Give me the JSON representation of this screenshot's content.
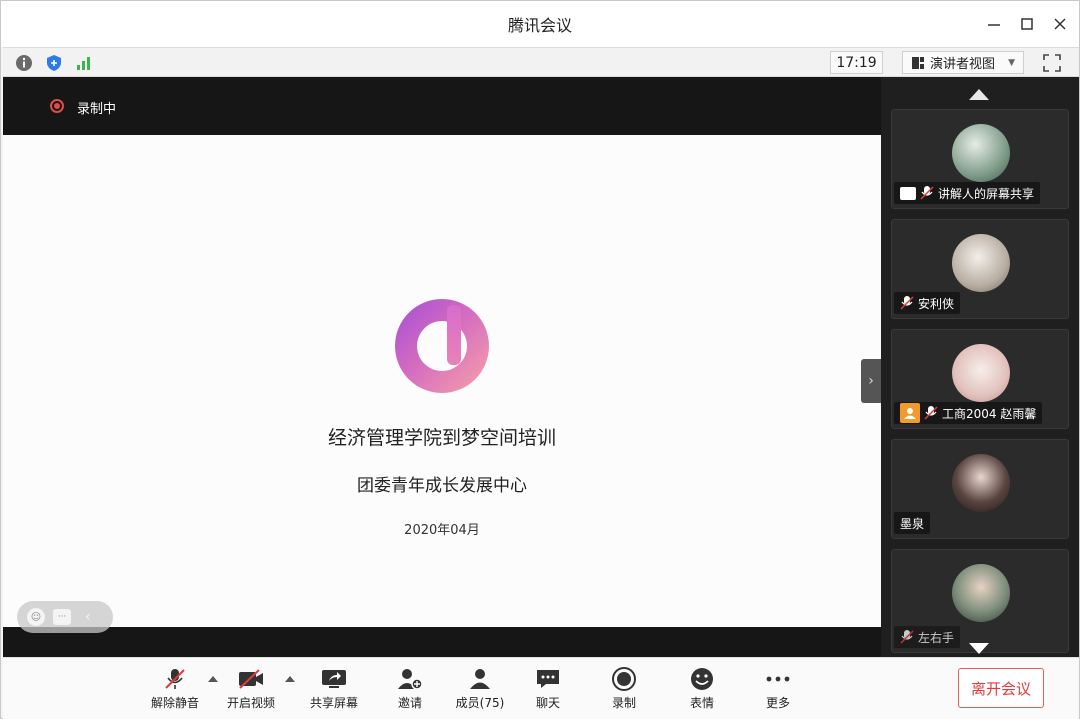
{
  "window": {
    "title": "腾讯会议"
  },
  "topbar": {
    "clock": "17:19",
    "view_label": "演讲者视图"
  },
  "recording": {
    "label": "录制中"
  },
  "slide": {
    "title": "经济管理学院到梦空间培训",
    "subtitle": "团委青年成长发展中心",
    "date": "2020年04月"
  },
  "participants": [
    {
      "name": "讲解人的屏幕共享",
      "sharing": true,
      "muted": true,
      "host": false,
      "avatar_color": "#9db3a4"
    },
    {
      "name": "安利侠",
      "sharing": false,
      "muted": true,
      "host": false,
      "avatar_color": "#c9c2b8"
    },
    {
      "name": "工商2004 赵雨馨",
      "sharing": false,
      "muted": true,
      "host": true,
      "avatar_color": "#e6c9c4"
    },
    {
      "name": "墨泉",
      "sharing": false,
      "muted": false,
      "host": false,
      "avatar_color": "#3a3030"
    },
    {
      "name": "左右手",
      "sharing": false,
      "muted": true,
      "host": false,
      "avatar_color": "#4b5a4a"
    }
  ],
  "controls": {
    "unmute": "解除静音",
    "start_video": "开启视频",
    "share_screen": "共享屏幕",
    "invite": "邀请",
    "members": "成员(75)",
    "chat": "聊天",
    "record": "录制",
    "reactions": "表情",
    "more": "更多",
    "leave": "离开会议"
  },
  "colors": {
    "accent_red": "#e33b3b",
    "signal_green": "#3cb54a",
    "shield_blue": "#2f7be6"
  }
}
